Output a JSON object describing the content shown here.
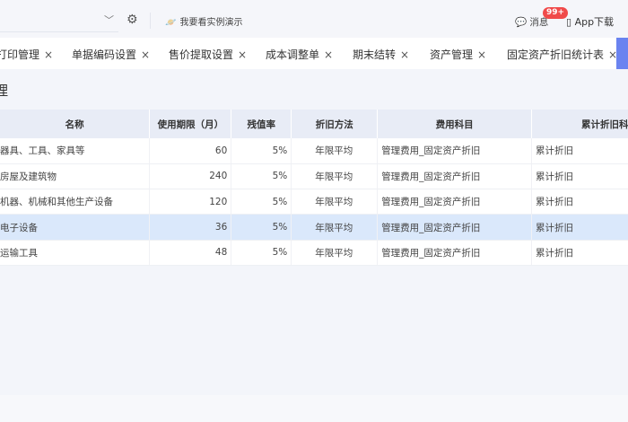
{
  "topbar": {
    "demo_label": "我要看实例演示",
    "messages_label": "消息",
    "messages_badge": "99+",
    "app_label": "App下载"
  },
  "tabs": [
    {
      "label": "打印管理"
    },
    {
      "label": "单据编码设置"
    },
    {
      "label": "售价提取设置"
    },
    {
      "label": "成本调整单"
    },
    {
      "label": "期末结转"
    },
    {
      "label": "资产管理"
    },
    {
      "label": "固定资产折旧统计表"
    }
  ],
  "page_title": "理",
  "table": {
    "columns": [
      "名称",
      "使用期限（月）",
      "残值率",
      "折旧方法",
      "费用科目",
      "累计折旧科"
    ],
    "rows": [
      [
        "器具、工具、家具等",
        "60",
        "5%",
        "年限平均",
        "管理费用_固定资产折旧",
        "累计折旧"
      ],
      [
        "房屋及建筑物",
        "240",
        "5%",
        "年限平均",
        "管理费用_固定资产折旧",
        "累计折旧"
      ],
      [
        "机器、机械和其他生产设备",
        "120",
        "5%",
        "年限平均",
        "管理费用_固定资产折旧",
        "累计折旧"
      ],
      [
        "电子设备",
        "36",
        "5%",
        "年限平均",
        "管理费用_固定资产折旧",
        "累计折旧"
      ],
      [
        "运输工具",
        "48",
        "5%",
        "年限平均",
        "管理费用_固定资产折旧",
        "累计折旧"
      ]
    ],
    "selected_row": 3
  }
}
